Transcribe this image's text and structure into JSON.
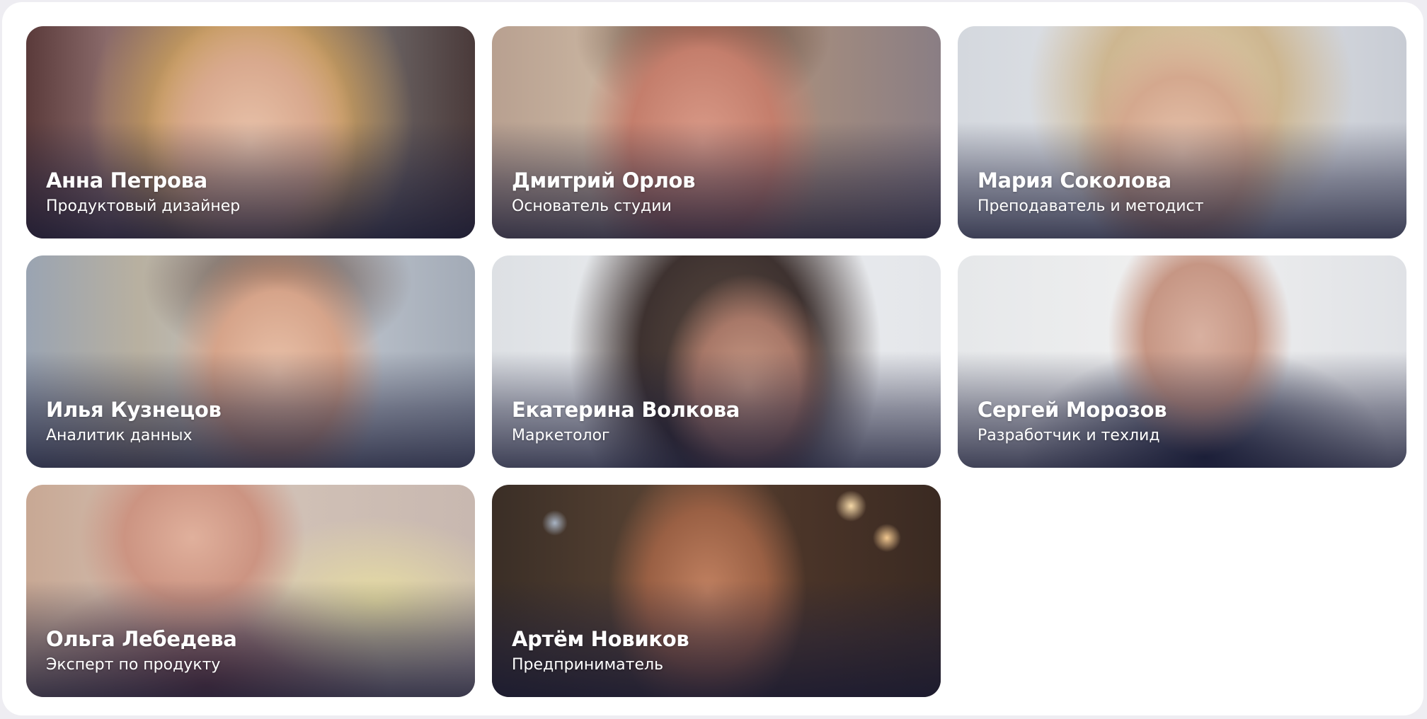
{
  "people": [
    {
      "name": "Анна Петрова",
      "role": "Продуктовый дизайнер"
    },
    {
      "name": "Дмитрий Орлов",
      "role": "Основатель студии"
    },
    {
      "name": "Мария Соколова",
      "role": "Преподаватель и методист"
    },
    {
      "name": "Илья Кузнецов",
      "role": "Аналитик данных"
    },
    {
      "name": "Екатерина Волкова",
      "role": "Маркетолог"
    },
    {
      "name": "Сергей Морозов",
      "role": "Разработчик и техлид"
    },
    {
      "name": "Ольга Лебедева",
      "role": "Эксперт по продукту"
    },
    {
      "name": "Артём Новиков",
      "role": "Предприниматель"
    }
  ]
}
